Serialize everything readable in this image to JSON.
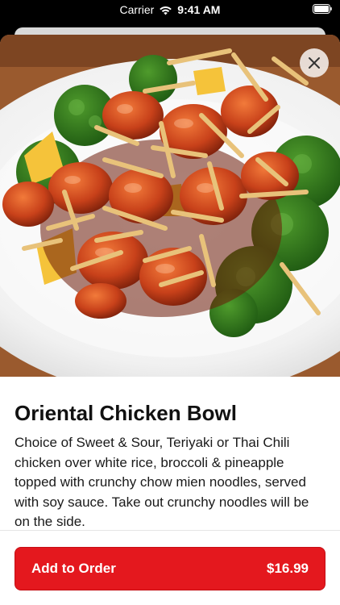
{
  "status_bar": {
    "carrier": "Carrier",
    "time": "9:41 AM",
    "wifi_icon": "wifi-icon",
    "battery_icon": "battery-icon"
  },
  "item": {
    "title": "Oriental Chicken Bowl",
    "description": "Choice of Sweet & Sour, Teriyaki or Thai Chili chicken over white rice, broccoli & pineapple topped with crunchy chow mien noodles, served with soy sauce. Take out crunchy noodles will be on the side.",
    "image": "food-photo"
  },
  "close": {
    "icon": "close-icon"
  },
  "order": {
    "label": "Add to Order",
    "price": "$16.99",
    "color": "#e4181e"
  }
}
